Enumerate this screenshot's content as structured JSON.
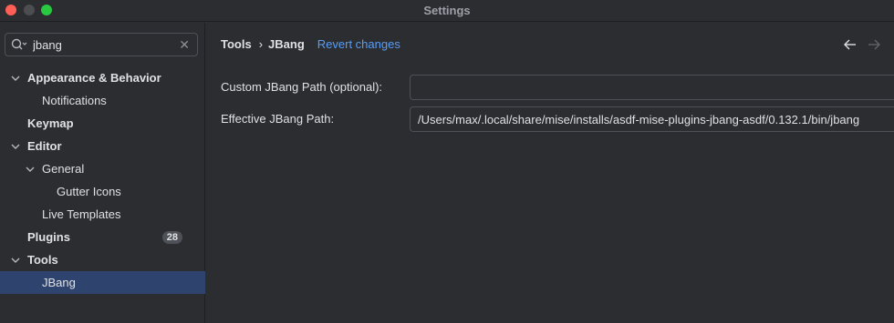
{
  "window": {
    "title": "Settings"
  },
  "search": {
    "value": "jbang"
  },
  "sidebar": {
    "items": [
      {
        "label": "Appearance & Behavior",
        "level": 0,
        "expanded": true,
        "bold": true
      },
      {
        "label": "Notifications",
        "level": 1
      },
      {
        "label": "Keymap",
        "level": 0,
        "bold": true
      },
      {
        "label": "Editor",
        "level": 0,
        "expanded": true,
        "bold": true
      },
      {
        "label": "General",
        "level": 1,
        "expanded": true
      },
      {
        "label": "Gutter Icons",
        "level": 2
      },
      {
        "label": "Live Templates",
        "level": 1
      },
      {
        "label": "Plugins",
        "level": 0,
        "bold": true,
        "badge": "28"
      },
      {
        "label": "Tools",
        "level": 0,
        "expanded": true,
        "bold": true
      },
      {
        "label": "JBang",
        "level": 1,
        "selected": true
      }
    ]
  },
  "breadcrumb": {
    "parent": "Tools",
    "current": "JBang",
    "separator": "›"
  },
  "header": {
    "revert_label": "Revert changes"
  },
  "form": {
    "custom_path_label": "Custom JBang Path (optional):",
    "custom_path_value": "",
    "effective_path_label": "Effective JBang Path:",
    "effective_path_value": "/Users/max/.local/share/mise/installs/asdf-mise-plugins-jbang-asdf/0.132.1/bin/jbang"
  },
  "icons": {
    "search": "search-icon",
    "clear": "close-icon",
    "back": "arrow-left-icon",
    "forward": "arrow-right-icon",
    "chevron": "chevron-down-icon"
  },
  "colors": {
    "background": "#2b2d30",
    "selection": "#2e436e",
    "link": "#589df6",
    "close": "#ff5f57",
    "maximize": "#28c840"
  }
}
